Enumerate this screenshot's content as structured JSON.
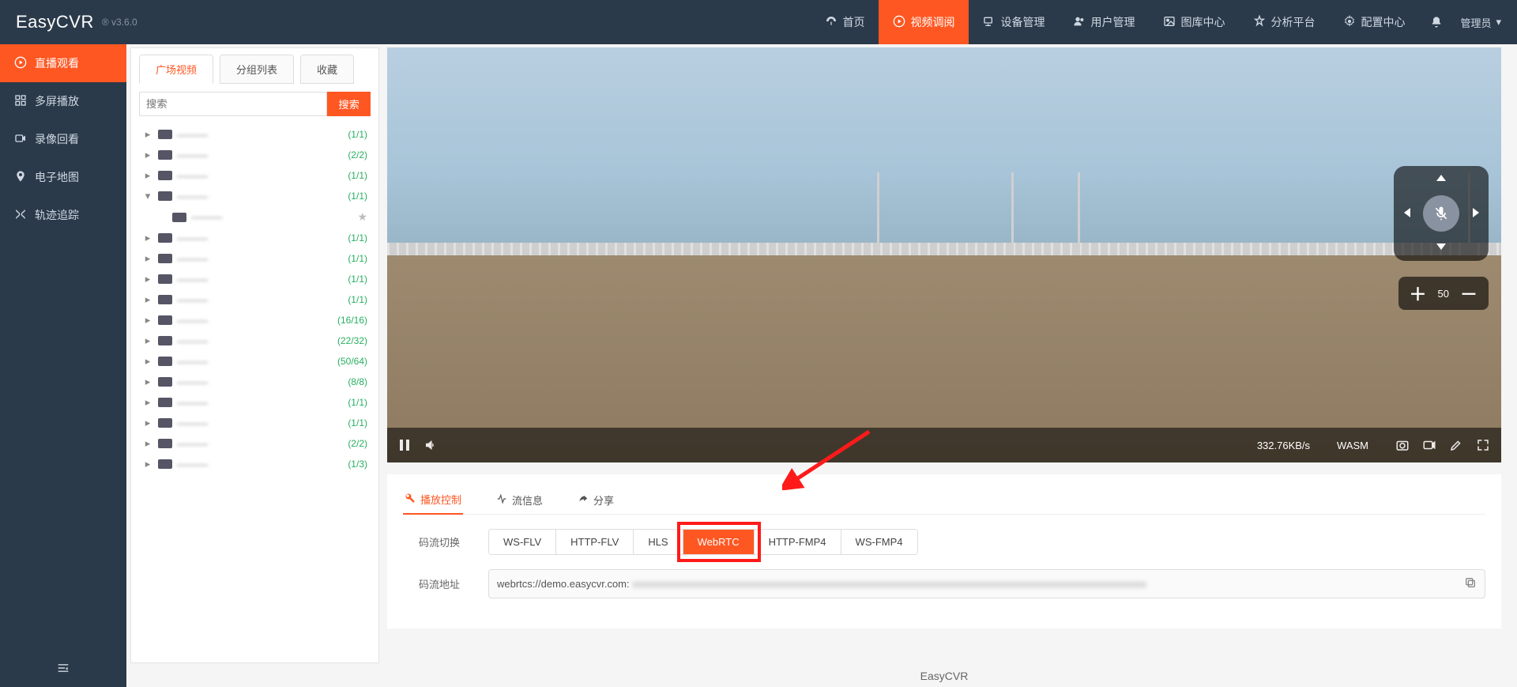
{
  "brand": {
    "name": "EasyCVR",
    "version": "® v3.6.0"
  },
  "topnav": [
    {
      "label": "首页",
      "icon": "dashboard"
    },
    {
      "label": "视频调阅",
      "icon": "play-circle",
      "active": true
    },
    {
      "label": "设备管理",
      "icon": "devices"
    },
    {
      "label": "用户管理",
      "icon": "users"
    },
    {
      "label": "图库中心",
      "icon": "image"
    },
    {
      "label": "分析平台",
      "icon": "analytics"
    },
    {
      "label": "配置中心",
      "icon": "settings"
    }
  ],
  "user_menu": {
    "label": "管理员"
  },
  "leftnav": [
    {
      "label": "直播观看",
      "icon": "play",
      "active": true
    },
    {
      "label": "多屏播放",
      "icon": "grid"
    },
    {
      "label": "录像回看",
      "icon": "record"
    },
    {
      "label": "电子地图",
      "icon": "map-pin"
    },
    {
      "label": "轨迹追踪",
      "icon": "route"
    }
  ],
  "tree_tabs": [
    {
      "label": "广场视频",
      "active": true
    },
    {
      "label": "分组列表"
    },
    {
      "label": "收藏"
    }
  ],
  "search": {
    "placeholder": "搜索",
    "button": "搜索"
  },
  "tree": [
    {
      "caret": "right",
      "label": "———",
      "count": "(1/1)"
    },
    {
      "caret": "right",
      "label": "———",
      "count": "(2/2)"
    },
    {
      "caret": "right",
      "label": "———",
      "count": "(1/1)"
    },
    {
      "caret": "down",
      "label": "———",
      "count": "(1/1)"
    },
    {
      "caret": "none",
      "label": "———",
      "star": true,
      "indent": true
    },
    {
      "caret": "right",
      "label": "———",
      "count": "(1/1)"
    },
    {
      "caret": "right",
      "label": "———",
      "count": "(1/1)"
    },
    {
      "caret": "right",
      "label": "———",
      "count": "(1/1)"
    },
    {
      "caret": "right",
      "label": "———",
      "count": "(1/1)"
    },
    {
      "caret": "right",
      "label": "———",
      "count": "(16/16)"
    },
    {
      "caret": "right",
      "label": "———",
      "count": "(22/32)"
    },
    {
      "caret": "right",
      "label": "———",
      "count": "(50/64)"
    },
    {
      "caret": "right",
      "label": "———",
      "count": "(8/8)"
    },
    {
      "caret": "right",
      "label": "———",
      "count": "(1/1)"
    },
    {
      "caret": "right",
      "label": "———",
      "count": "(1/1)"
    },
    {
      "caret": "right",
      "label": "———",
      "count": "(2/2)"
    },
    {
      "caret": "right",
      "label": "———",
      "count": "(1/3)"
    }
  ],
  "player": {
    "bitrate": "332.76KB/s",
    "decoder": "WASM",
    "zoom_value": "50"
  },
  "stream_tabs": [
    {
      "label": "播放控制",
      "icon": "tools",
      "active": true
    },
    {
      "label": "流信息",
      "icon": "activity"
    },
    {
      "label": "分享",
      "icon": "share"
    }
  ],
  "stream_switch": {
    "label": "码流切换",
    "options": [
      "WS-FLV",
      "HTTP-FLV",
      "HLS",
      "WebRTC",
      "HTTP-FMP4",
      "WS-FMP4"
    ],
    "active": "WebRTC"
  },
  "stream_url": {
    "label": "码流地址",
    "value_visible": "webrtcs://demo.easycvr.com:",
    "value_hidden": "xxxxxxxxxxxxxxxxxxxxxxxxxxxxxxxxxxxxxxxxxxxxxxxxxxxxxxxxxxxxxxxxxxxxxxxxxxxxxxxxxxxxxxxxxxxxxxxxxxxx"
  },
  "footer": "EasyCVR"
}
